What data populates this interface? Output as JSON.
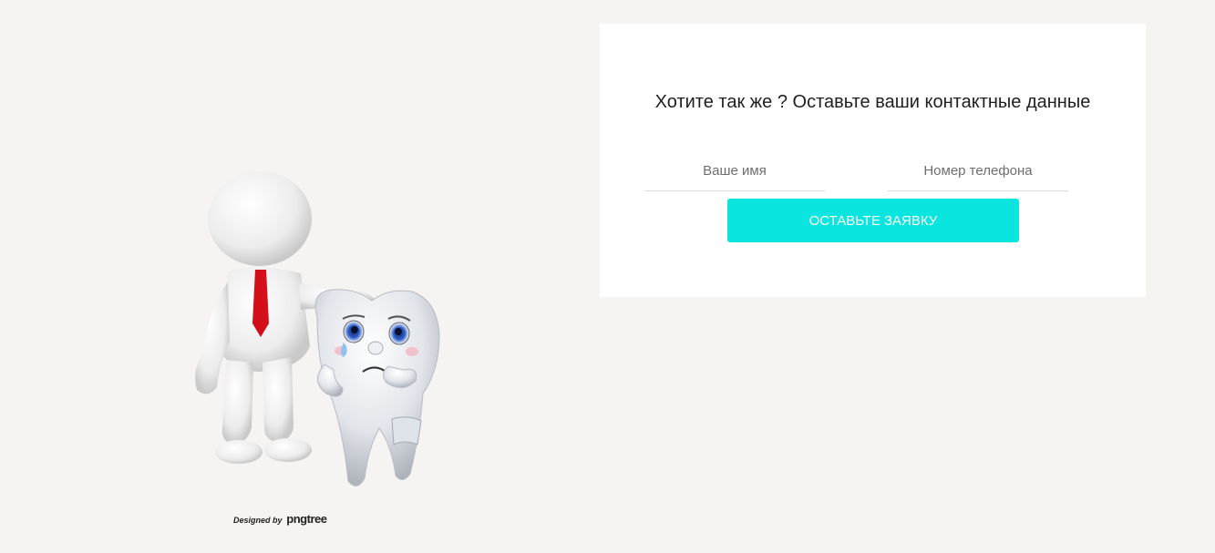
{
  "form": {
    "title": "Хотите так же ? Оставьте ваши контактные данные",
    "name_placeholder": "Ваше имя",
    "phone_placeholder": "Номер телефона",
    "submit_label": "ОСТАВЬТЕ ЗАЯВКУ"
  },
  "illustration": {
    "credit_prefix": "Designed by",
    "credit_brand": "pngtree"
  },
  "colors": {
    "page_background": "#f5f4f3",
    "card_background": "#ffffff",
    "accent": "#0ae6df",
    "tie": "#d3101a"
  },
  "icons": {
    "illustration": "man-with-crying-tooth-illustration"
  }
}
